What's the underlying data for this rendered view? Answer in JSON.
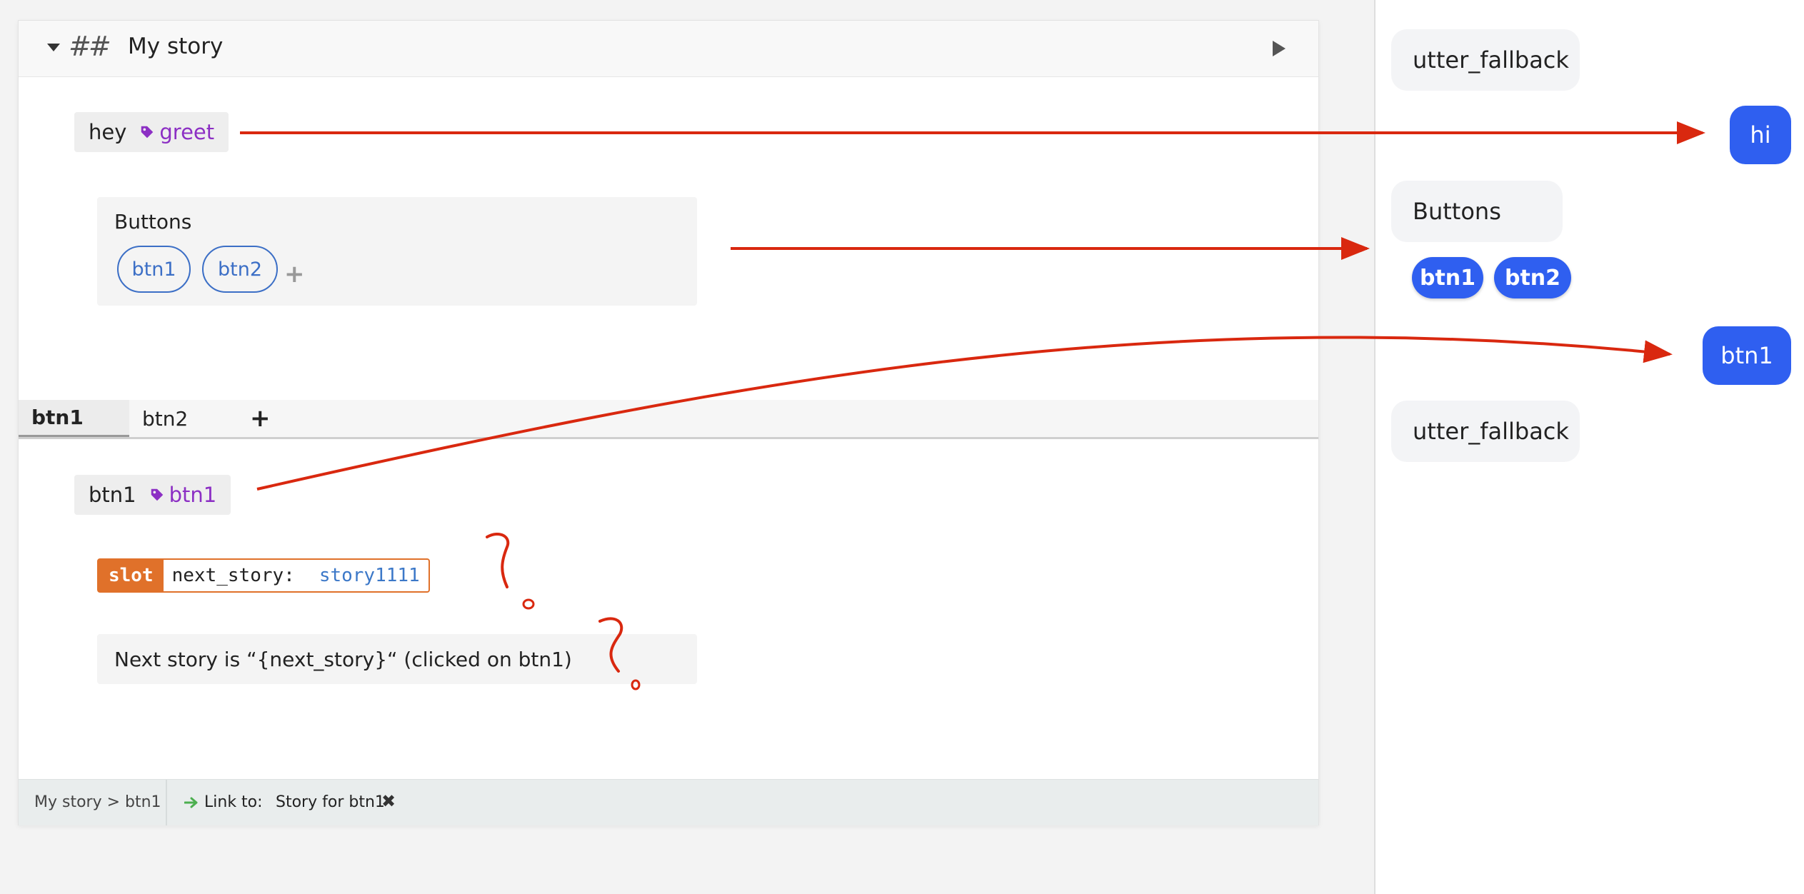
{
  "story": {
    "title": "My story",
    "hash_glyph": "##",
    "user_step_1": {
      "text": "hey",
      "intent": "greet"
    },
    "bot_buttons": {
      "title": "Buttons",
      "buttons": [
        "btn1",
        "btn2"
      ],
      "add_glyph": "+"
    },
    "branch_tabs": {
      "tabs": [
        "btn1",
        "btn2"
      ],
      "active": "btn1",
      "add_glyph": "+"
    },
    "user_step_2": {
      "text": "btn1",
      "intent": "btn1"
    },
    "slot": {
      "label": "slot",
      "name": "next_story:",
      "value": "story1111"
    },
    "bot_text": "Next story is “{next_story}“ (clicked on btn1)",
    "footer": {
      "breadcrumb": "My story > btn1",
      "link_label": "Link to:",
      "linked_story": "Story for btn1",
      "unlink_glyph": "✖"
    }
  },
  "chat": {
    "messages": [
      {
        "from": "bot",
        "text": "utter_fallback"
      },
      {
        "from": "user",
        "text": "hi"
      },
      {
        "from": "bot",
        "text": "Buttons"
      },
      {
        "from": "user",
        "text": "btn1"
      },
      {
        "from": "bot",
        "text": "utter_fallback"
      }
    ],
    "quick_replies": [
      "btn1",
      "btn2"
    ]
  },
  "colors": {
    "intent": "#8c2fc4",
    "button_outline": "#3c6fc6",
    "slot": "#e0712a",
    "slot_value": "#3c78c8",
    "chat_user": "#2f5ff0",
    "annotation": "#d9280f",
    "link_arrow": "#4caf50"
  },
  "icons": [
    "caret-down-icon",
    "play-icon",
    "tag-icon",
    "plus-icon",
    "arrow-right-icon",
    "close-icon"
  ]
}
